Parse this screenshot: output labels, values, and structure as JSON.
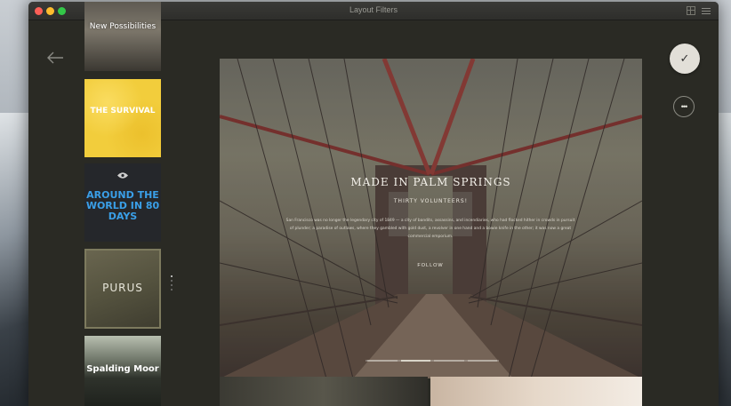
{
  "window": {
    "title": "Layout Filters"
  },
  "thumbnails": [
    {
      "label": "New Possibilities"
    },
    {
      "label": "THE SURVIVAL"
    },
    {
      "label": "AROUND THE WORLD IN 80 DAYS"
    },
    {
      "label": "PURUS"
    },
    {
      "label": "Spalding Moor"
    }
  ],
  "hero": {
    "title": "MADE IN PALM SPRINGS",
    "subtitle": "THIRTY VOLUNTEERS!",
    "body": "San Francisco was no longer the legendary city of 1849 — a city of bandits, assassins, and incendiaries, who had flocked hither in crowds in pursuit of plunder; a paradise of outlaws, where they gambled with gold dust, a revolver in one hand and a bowie knife in the other; it was now a great commercial emporium.",
    "follow_label": "FOLLOW",
    "progress_segments": 4,
    "progress_active": 1
  },
  "actions": {
    "confirm_icon": "✓",
    "more_icon": "•••"
  },
  "colors": {
    "accent_yellow": "#f2cd3c",
    "accent_blue": "#3a9fe8",
    "window_bg": "#2a2a24"
  }
}
